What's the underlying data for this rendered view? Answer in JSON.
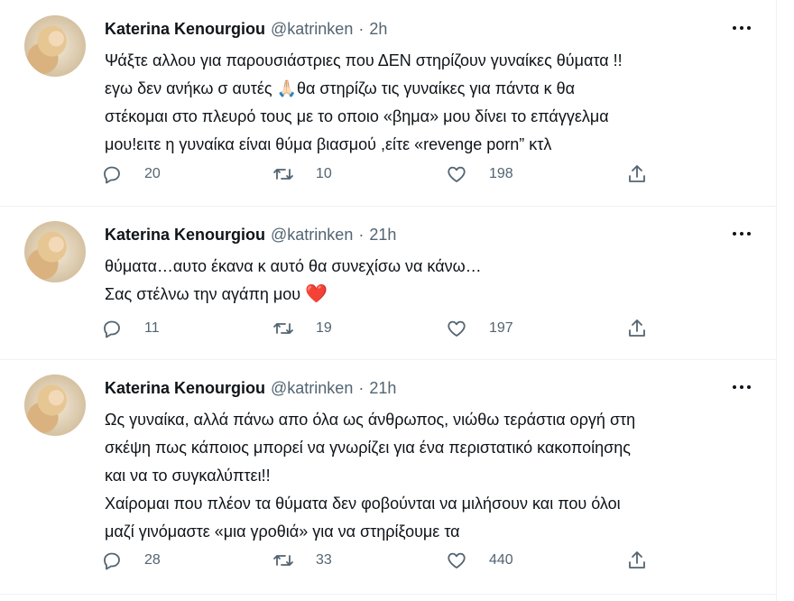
{
  "tweets": [
    {
      "author": "Katerina Kenourgiou",
      "handle": "@katrinken",
      "separator": "·",
      "time": "2h",
      "lines": [
        "Ψάξτε αλλου για παρουσιάστριες που ΔΕΝ στηρίζουν γυναίκες θύματα !!",
        "εγω δεν ανήκω σ αυτές 🙏🏻θα στηρίζω τις γυναίκες για πάντα κ θα",
        "στέκομαι στο πλευρό τους με το οποιο «βημα» μου δίνει το επάγγελμα",
        "μου!ειτε η γυναίκα είναι θύμα βιασμού ,είτε «revenge porn” κτλ"
      ],
      "reply_count": "20",
      "retweet_count": "10",
      "like_count": "198"
    },
    {
      "author": "Katerina Kenourgiou",
      "handle": "@katrinken",
      "separator": "·",
      "time": "21h",
      "lines": [
        "θύματα…αυτο έκανα κ αυτό θα συνεχίσω να κάνω…",
        "Σας στέλνω την αγάπη μου"
      ],
      "heart_emoji": "❤️",
      "reply_count": "11",
      "retweet_count": "19",
      "like_count": "197"
    },
    {
      "author": "Katerina Kenourgiou",
      "handle": "@katrinken",
      "separator": "·",
      "time": "21h",
      "lines": [
        "Ως γυναίκα, αλλά πάνω απο όλα ως άνθρωπος, νιώθω τεράστια οργή στη",
        "σκέψη πως κάποιος μπορεί να γνωρίζει για ένα περιστατικό κακοποίησης",
        "και να το συγκαλύπτει!!",
        "Χαίρομαι που πλέον τα θύματα δεν φοβούνται να μιλήσουν και που όλοι",
        "μαζί γινόμαστε «μια γροθιά» για να στηρίξουμε τα"
      ],
      "reply_count": "28",
      "retweet_count": "33",
      "like_count": "440"
    }
  ],
  "icons": {
    "reply": "reply-icon",
    "retweet": "retweet-icon",
    "like": "like-icon",
    "share": "share-icon",
    "more": "more-icon"
  },
  "colors": {
    "text": "#0f1419",
    "secondary": "#536471",
    "divider": "#eff3f4",
    "heart": "#dd2e44"
  }
}
